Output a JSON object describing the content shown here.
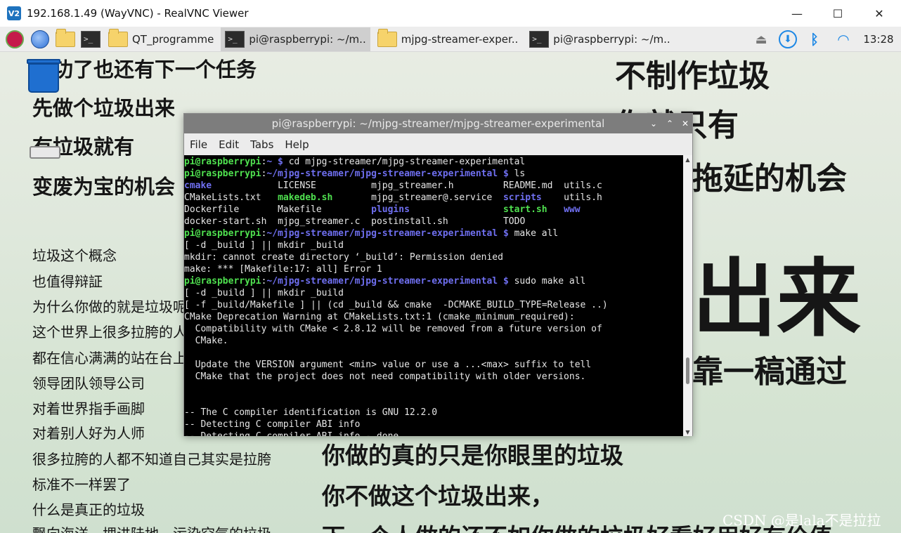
{
  "vnc": {
    "title": "192.168.1.49 (WayVNC) - RealVNC Viewer",
    "logo": "V2",
    "minimize": "—",
    "maximize": "☐",
    "close": "✕"
  },
  "taskbar": {
    "tasks": [
      {
        "label": "QT_programme",
        "icon": "folder-icon"
      },
      {
        "label": "pi@raspberrypi: ~/m..",
        "icon": "terminal-icon",
        "active": true
      },
      {
        "label": "mjpg-streamer-exper..",
        "icon": "folder-icon"
      },
      {
        "label": "pi@raspberrypi: ~/m..",
        "icon": "terminal-icon"
      }
    ],
    "tray": {
      "eject": "⏏",
      "download": "⬇",
      "bluetooth": "ᛒ",
      "wifi": "◠",
      "clock": "13:28"
    }
  },
  "desktop": {
    "trash_label": "Wastebasket"
  },
  "wallpaper": {
    "left_top": [
      "成功了也还有下一个任务",
      "先做个垃圾出来",
      "有垃圾就有",
      "变废为宝的机会"
    ],
    "left_small": [
      "垃圾这个概念",
      "也值得辩証",
      "为什么你做的就是垃圾呢",
      "这个世界上很多拉胯的人",
      "都在信心满满的站在台上",
      "领导团队领导公司",
      "对着世界指手画脚",
      "对着别人好为人师",
      "很多拉胯的人都不知道自己其实是拉胯",
      "标准不一样罢了",
      "什么是真正的垃圾",
      "飘向海洋，埋进陆地，污染空气的垃圾"
    ],
    "right_top": [
      "不制作垃圾",
      "你就只有",
      "拖延的机会"
    ],
    "right_big": "出来",
    "right_mid": "靠一稿通过",
    "bottom": [
      "你做的真的只是你眼里的垃圾",
      "你不做这个垃圾出来，",
      "下一个人做的还不如你做的垃圾好看好用好有价值"
    ],
    "watermark": "CSDN @是lala不是拉拉"
  },
  "terminal": {
    "title": "pi@raspberrypi: ~/mjpg-streamer/mjpg-streamer-experimental",
    "menu": [
      "File",
      "Edit",
      "Tabs",
      "Help"
    ],
    "lines": [
      [
        {
          "t": "pi@raspberrypi",
          "c": "prompt-user"
        },
        {
          "t": ":",
          "c": "c-plain"
        },
        {
          "t": "~ $",
          "c": "prompt-path"
        },
        {
          "t": " cd mjpg-streamer/mjpg-streamer-experimental",
          "c": "c-plain"
        }
      ],
      [
        {
          "t": "pi@raspberrypi",
          "c": "prompt-user"
        },
        {
          "t": ":",
          "c": "c-plain"
        },
        {
          "t": "~/mjpg-streamer/mjpg-streamer-experimental $",
          "c": "prompt-path"
        },
        {
          "t": " ls",
          "c": "c-plain"
        }
      ],
      [
        {
          "t": "cmake",
          "c": "c-dir",
          "w": 17
        },
        {
          "t": "LICENSE",
          "c": "c-plain",
          "w": 17
        },
        {
          "t": "mjpg_streamer.h",
          "c": "c-plain",
          "w": 24
        },
        {
          "t": "README.md",
          "c": "c-plain",
          "w": 11
        },
        {
          "t": "utils.c",
          "c": "c-plain"
        }
      ],
      [
        {
          "t": "CMakeLists.txt",
          "c": "c-plain",
          "w": 17
        },
        {
          "t": "makedeb.sh",
          "c": "c-exe",
          "w": 17
        },
        {
          "t": "mjpg_streamer@.service",
          "c": "c-plain",
          "w": 24
        },
        {
          "t": "scripts",
          "c": "c-dir",
          "w": 11
        },
        {
          "t": "utils.h",
          "c": "c-plain"
        }
      ],
      [
        {
          "t": "Dockerfile",
          "c": "c-plain",
          "w": 17
        },
        {
          "t": "Makefile",
          "c": "c-plain",
          "w": 17
        },
        {
          "t": "plugins",
          "c": "c-dir",
          "w": 24
        },
        {
          "t": "start.sh",
          "c": "c-exe",
          "w": 11
        },
        {
          "t": "www",
          "c": "c-dir"
        }
      ],
      [
        {
          "t": "docker-start.sh",
          "c": "c-plain",
          "w": 17
        },
        {
          "t": "mjpg_streamer.c",
          "c": "c-plain",
          "w": 17
        },
        {
          "t": "postinstall.sh",
          "c": "c-plain",
          "w": 24
        },
        {
          "t": "TODO",
          "c": "c-plain"
        }
      ],
      [
        {
          "t": "pi@raspberrypi",
          "c": "prompt-user"
        },
        {
          "t": ":",
          "c": "c-plain"
        },
        {
          "t": "~/mjpg-streamer/mjpg-streamer-experimental $",
          "c": "prompt-path"
        },
        {
          "t": " make all",
          "c": "c-plain"
        }
      ],
      [
        {
          "t": "[ -d _build ] || mkdir _build",
          "c": "c-plain"
        }
      ],
      [
        {
          "t": "mkdir: cannot create directory ‘_build’: Permission denied",
          "c": "c-plain"
        }
      ],
      [
        {
          "t": "make: *** [Makefile:17: all] Error 1",
          "c": "c-plain"
        }
      ],
      [
        {
          "t": "pi@raspberrypi",
          "c": "prompt-user"
        },
        {
          "t": ":",
          "c": "c-plain"
        },
        {
          "t": "~/mjpg-streamer/mjpg-streamer-experimental $",
          "c": "prompt-path"
        },
        {
          "t": " sudo make all",
          "c": "c-plain"
        }
      ],
      [
        {
          "t": "[ -d _build ] || mkdir _build",
          "c": "c-plain"
        }
      ],
      [
        {
          "t": "[ -f _build/Makefile ] || (cd _build && cmake  -DCMAKE_BUILD_TYPE=Release ..)",
          "c": "c-plain"
        }
      ],
      [
        {
          "t": "CMake Deprecation Warning at CMakeLists.txt:1 (cmake_minimum_required):",
          "c": "c-plain"
        }
      ],
      [
        {
          "t": "  Compatibility with CMake < 2.8.12 will be removed from a future version of",
          "c": "c-plain"
        }
      ],
      [
        {
          "t": "  CMake.",
          "c": "c-plain"
        }
      ],
      [
        {
          "t": "",
          "c": "c-plain"
        }
      ],
      [
        {
          "t": "  Update the VERSION argument <min> value or use a ...<max> suffix to tell",
          "c": "c-plain"
        }
      ],
      [
        {
          "t": "  CMake that the project does not need compatibility with older versions.",
          "c": "c-plain"
        }
      ],
      [
        {
          "t": "",
          "c": "c-plain"
        }
      ],
      [
        {
          "t": "",
          "c": "c-plain"
        }
      ],
      [
        {
          "t": "-- The C compiler identification is GNU 12.2.0",
          "c": "c-plain"
        }
      ],
      [
        {
          "t": "-- Detecting C compiler ABI info",
          "c": "c-plain"
        }
      ],
      [
        {
          "t": "-- Detecting C compiler ABI info - done",
          "c": "c-plain"
        }
      ]
    ],
    "scroll_up": "▲",
    "scroll_down": "▼",
    "win_min": "⌄",
    "win_max": "⌃",
    "win_close": "✕"
  }
}
